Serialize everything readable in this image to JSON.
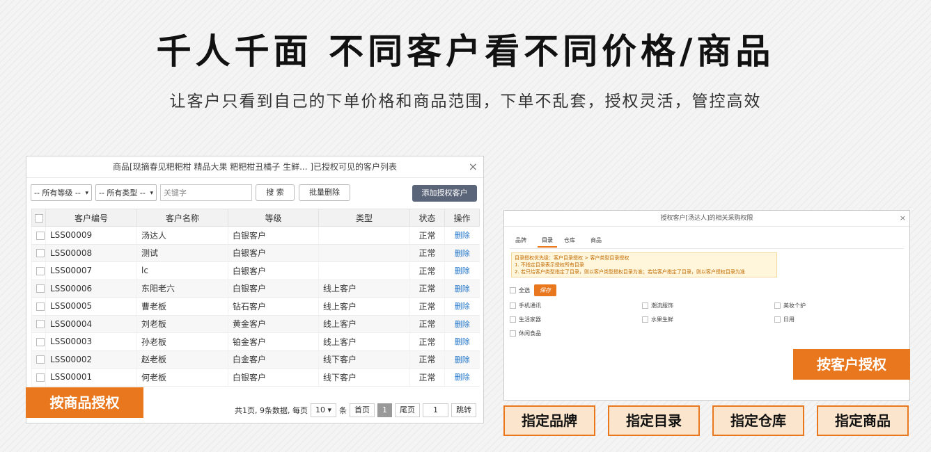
{
  "hero": {
    "title": "千人千面  不同客户看不同价格/商品",
    "subtitle": "让客户只看到自己的下单价格和商品范围，下单不乱套，授权灵活，管控高效"
  },
  "left_dialog": {
    "title": "商品[现摘春见粑粑柑 精品大果 粑粑柑丑橘子 生鲜... ]已授权可见的客户列表",
    "filters": {
      "level_select": "-- 所有等级 --",
      "type_select": "-- 所有类型 --",
      "keyword_placeholder": "关键字",
      "search_label": "搜 索",
      "batch_delete_label": "批量删除",
      "add_label": "添加授权客户"
    },
    "columns": [
      "客户编号",
      "客户名称",
      "等级",
      "类型",
      "状态",
      "操作"
    ],
    "rows": [
      {
        "code": "LSS00009",
        "name": "汤达人",
        "level": "白银客户",
        "type": "",
        "status": "正常",
        "action": "删除"
      },
      {
        "code": "LSS00008",
        "name": "测试",
        "level": "白银客户",
        "type": "",
        "status": "正常",
        "action": "删除"
      },
      {
        "code": "LSS00007",
        "name": "lc",
        "level": "白银客户",
        "type": "",
        "status": "正常",
        "action": "删除"
      },
      {
        "code": "LSS00006",
        "name": "东阳老六",
        "level": "白银客户",
        "type": "线上客户",
        "status": "正常",
        "action": "删除"
      },
      {
        "code": "LSS00005",
        "name": "曹老板",
        "level": "钻石客户",
        "type": "线上客户",
        "status": "正常",
        "action": "删除"
      },
      {
        "code": "LSS00004",
        "name": "刘老板",
        "level": "黄金客户",
        "type": "线上客户",
        "status": "正常",
        "action": "删除"
      },
      {
        "code": "LSS00003",
        "name": "孙老板",
        "level": "铂金客户",
        "type": "线上客户",
        "status": "正常",
        "action": "删除"
      },
      {
        "code": "LSS00002",
        "name": "赵老板",
        "level": "白金客户",
        "type": "线下客户",
        "status": "正常",
        "action": "删除"
      },
      {
        "code": "LSS00001",
        "name": "何老板",
        "level": "白银客户",
        "type": "线下客户",
        "status": "正常",
        "action": "删除"
      }
    ],
    "pager": {
      "summary": "共1页, 9条数据, 每页",
      "page_size": "10",
      "unit": "条",
      "first": "首页",
      "current": "1",
      "last": "尾页",
      "jump_value": "1",
      "jump": "跳转"
    },
    "tag": "按商品授权"
  },
  "right_dialog": {
    "title": "授权客户[汤达人]的相关采购权限",
    "tabs": [
      "品牌",
      "目录",
      "仓库",
      "商品"
    ],
    "active_tab": "目录",
    "notice": [
      "目录授权优先级：客户目录授权 > 客户类型目录授权",
      "1. 不指定目录表示授权所有目录",
      "2. 若只给客户类型指定了目录，则以客户类型授权目录为准；若给客户指定了目录，则以客户授权目录为准"
    ],
    "select_all": "全选",
    "save": "保存",
    "categories": [
      "手机通讯",
      "潮流服饰",
      "美妆个护",
      "生活家器",
      "水果生鲜",
      "日用",
      "休闲食品"
    ],
    "tag": "按客户授权"
  },
  "features": [
    "指定品牌",
    "指定目录",
    "指定仓库",
    "指定商品"
  ],
  "colors": {
    "accent": "#e8771e",
    "feature_bg": "#fbe6cd",
    "link": "#1e73c9",
    "dark_button": "#5b6579"
  }
}
